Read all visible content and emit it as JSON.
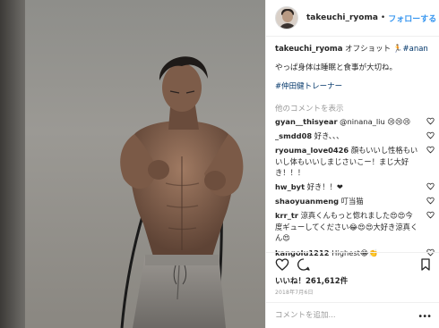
{
  "post": {
    "username": "takeuchi_ryoma",
    "dot": "•",
    "follow_label": "フォローする"
  },
  "caption": {
    "username": "takeuchi_ryoma",
    "text": "オフショット",
    "hashtag1": "#anan",
    "line2": "やっぱ身体は睡眠と食事が大切ね。",
    "hashtag2": "#仲田健トレーナー"
  },
  "more_comments_label": "他のコメントを表示",
  "comments": [
    {
      "user": "gyan__thisyear",
      "text": "@ninana_liu 😢😢😢"
    },
    {
      "user": "_smdd08",
      "text": "好き、、、"
    },
    {
      "user": "ryouma_love0426",
      "text": "顔もいいし性格もいいし体もいいしまじさいこー！まじ大好き！！！"
    },
    {
      "user": "hw_byt",
      "text": "好き！！❤"
    },
    {
      "user": "shaoyuanmeng",
      "text": "叮当猫"
    },
    {
      "user": "krr_tr",
      "text": "涼真くんもっと惚れました😍😍今度ギューしてください😂😍😍大好き涼真くん😍"
    },
    {
      "user": "kangolu1212",
      "text": "Highest😂👏"
    }
  ],
  "likes_label": "いいね！261,612件",
  "date": "2018年7月6日",
  "add_comment_placeholder": "コメントを追加...",
  "icons": {
    "like": "heart-icon",
    "comment": "comment-icon",
    "share": "share-icon",
    "save": "bookmark-icon",
    "options": "more-options-icon"
  },
  "colors": {
    "follow_blue": "#3897f0",
    "hashtag_blue": "#003569",
    "muted_gray": "#999999"
  }
}
